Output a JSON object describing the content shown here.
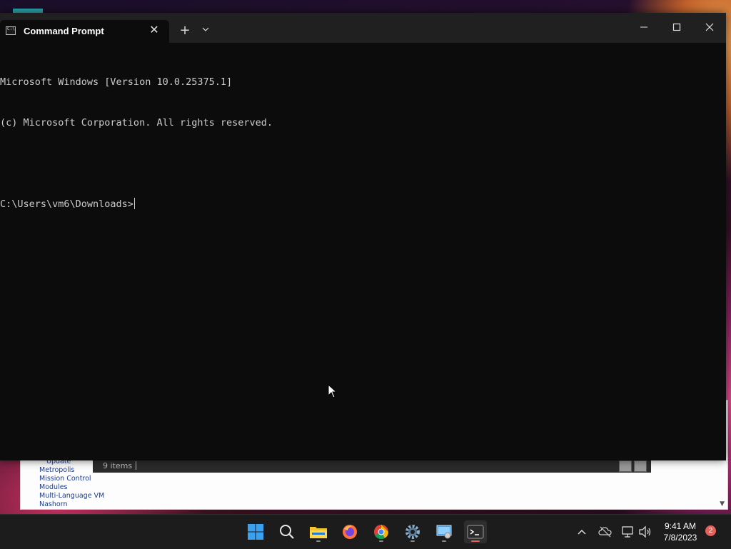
{
  "terminal": {
    "tab_title": "Command Prompt",
    "new_tab_label": "+",
    "close_tab_label": "✕",
    "lines": [
      "Microsoft Windows [Version 10.0.25375.1]",
      "(c) Microsoft Corporation. All rights reserved.",
      "",
      "C:\\Users\\vm6\\Downloads>"
    ]
  },
  "background_explorer": {
    "nav_items": [
      "Update",
      "Metropolis",
      "Mission Control",
      "Modules",
      "Multi-Language VM",
      "Nashorn"
    ],
    "status_items": "9 items"
  },
  "taskbar": {
    "apps": [
      "start",
      "search",
      "file-explorer",
      "firefox",
      "chrome",
      "settings",
      "control-panel",
      "terminal"
    ],
    "time": "9:41 AM",
    "date": "7/8/2023",
    "notification_count": "2"
  },
  "colors": {
    "terminal_bg": "#0c0c0c",
    "titlebar_bg": "#202020",
    "text": "#cccccc",
    "taskbar_bg": "#1c1c1c",
    "accent_red": "#e0635a"
  }
}
